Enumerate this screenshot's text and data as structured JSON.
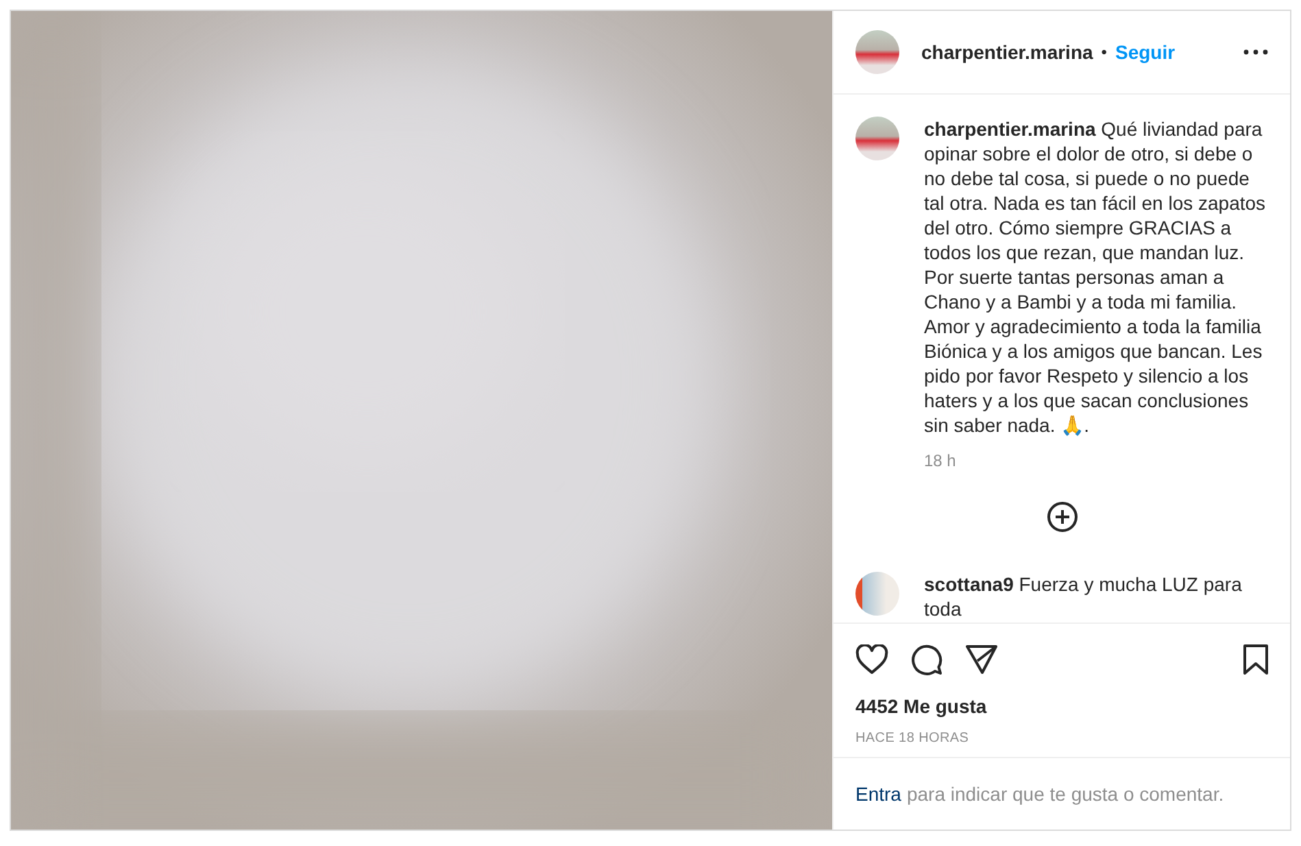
{
  "header": {
    "username": "charpentier.marina",
    "separator": "•",
    "follow": "Seguir"
  },
  "comments": [
    {
      "text": "**charpentier.marina** Qué liviandad para opinar sobre el dolor de otro, si debe o no debe tal cosa, si puede o no puede tal otra. Nada es tan fácil en los zapatos del otro. Cómo siempre GRACIAS a todos los que rezan, que mandan luz. Por suerte tantas personas aman a Chano y a Bambi y a toda mi familia. Amor y agradecimiento a toda la familia Biónica y a los amigos que bancan. Les pido por favor Respeto y silencio a los haters y a los que sacan conclusiones sin saber nada. 🙏.",
      "time": "18 h"
    },
    {
      "text": "**scottana9** Fuerza y mucha LUZ para toda"
    }
  ],
  "likes": "4452 Me gusta",
  "timestamp": "HACE 18 HORAS",
  "login": {
    "link": "Entra",
    "text": "para indicar que te gusta o comentar."
  }
}
